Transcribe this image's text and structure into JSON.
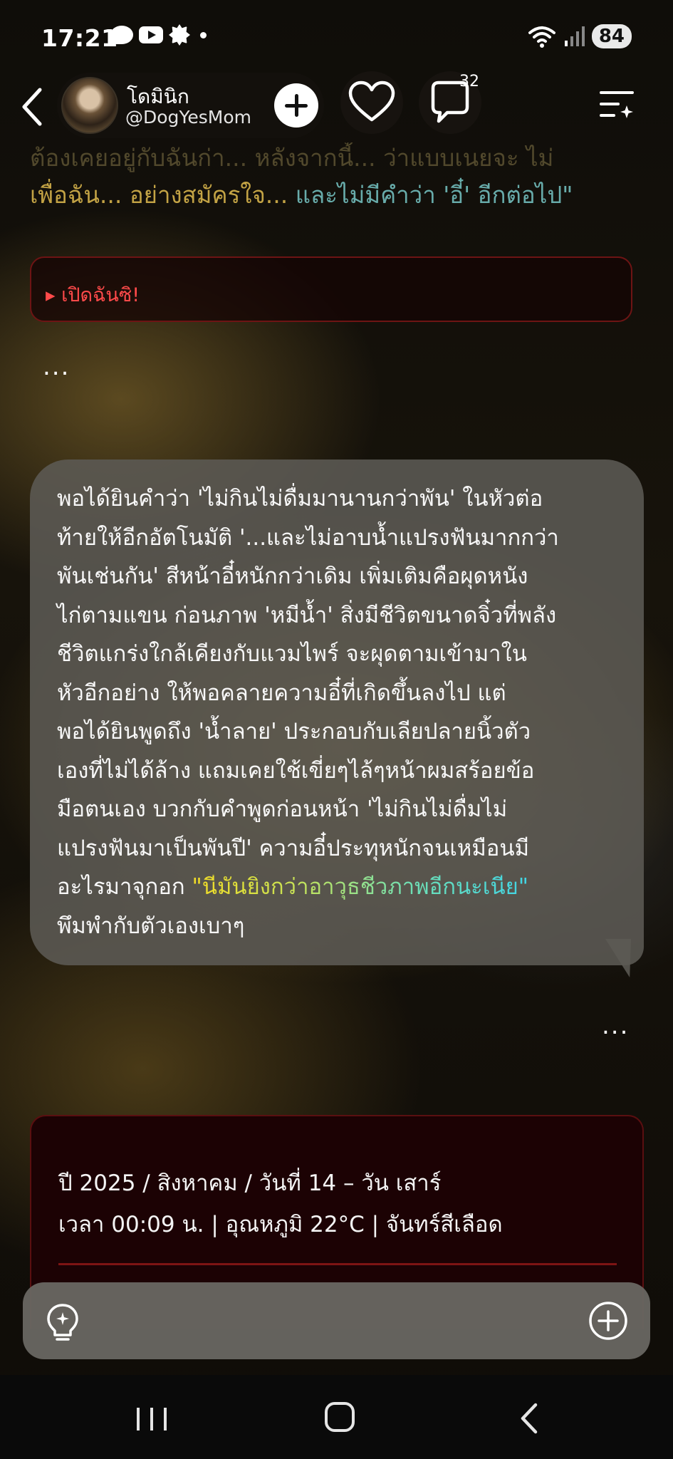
{
  "status_bar": {
    "time": "17:21",
    "battery": "84",
    "notification_icons": [
      "chat-bubble-icon",
      "youtube-icon",
      "gear-icon",
      "dot-icon"
    ],
    "system_icons": [
      "wifi-icon",
      "signal-icon"
    ]
  },
  "header": {
    "character_name": "โดมินิก",
    "handle": "@DogYesMom",
    "comment_count": "32"
  },
  "previous_message": {
    "line_1_faded": "ต้องเคยอยู่กับฉันก่า... หลังจากนี้... ว่าแบบเนยจะ ไม่",
    "line_2_part_warm": "เพื่อฉัน... อย่างสมัครใจ... ",
    "line_2_part_cool": "และไม่มีคำว่า 'อี๋' อีกต่อไป\""
  },
  "spoiler": {
    "label": "▸ เปิดฉันซิ!"
  },
  "ellipsis": "...",
  "message": {
    "lines": [
      "พอได้ยินคำว่า 'ไม่กินไม่ดื่มมานานกว่าพัน' ในหัวต่อ",
      "ท้ายให้อีกอัตโนมัติ '...และไม่อาบน้ำแปรงฟันมากกว่า",
      "พันเช่นกัน' สีหน้าอี๋หนักกว่าเดิม เพิ่มเติมคือผุดหนัง",
      "ไก่ตามแขน ก่อนภาพ 'หมีน้ำ' สิ่งมีชีวิตขนาดจิ๋วที่พลัง",
      "ชีวิตแกร่งใกล้เคียงกับแวมไพร์ จะผุดตามเข้ามาใน",
      "หัวอีกอย่าง ให้พอคลายความอี๋ที่เกิดขึ้นลงไป แต่",
      "พอได้ยินพูดถึง 'น้ำลาย' ประกอบกับเลียปลายนิ้วตัว",
      "เองที่ไม่ได้ล้าง แถมเคยใช้เขี่ยๆไล้ๆหน้าผมสร้อยข้อ",
      "มือตนเอง บวกกับคำพูดก่อนหน้า 'ไม่กินไม่ดื่มไม่",
      "แปรงฟันมาเป็นพันปี' ความอี๋ประทุหนักจนเหมือนมี"
    ],
    "line_11_prefix": "อะไรมาจุกอก ",
    "quote": "\"นี่มันยิ่งกว่าอาวุธชีวภาพอีกนะเนี่ย\"",
    "last_line": "พึมพำกับตัวเองเบาๆ"
  },
  "info_card": {
    "date_line": "ปี 2025 / สิงหาคม / วันที่ 14 – วัน เสาร์",
    "time_line": "เวลา 00:09 น. | อุณหภูมิ 22°C | จันทร์สีเลือด"
  },
  "input": {
    "placeholder": ""
  },
  "colors": {
    "spoiler_text": "#ff4a4a",
    "card_background": "#1c0204",
    "card_border": "#5a0f10",
    "bubble_background": "#5c5a54"
  }
}
